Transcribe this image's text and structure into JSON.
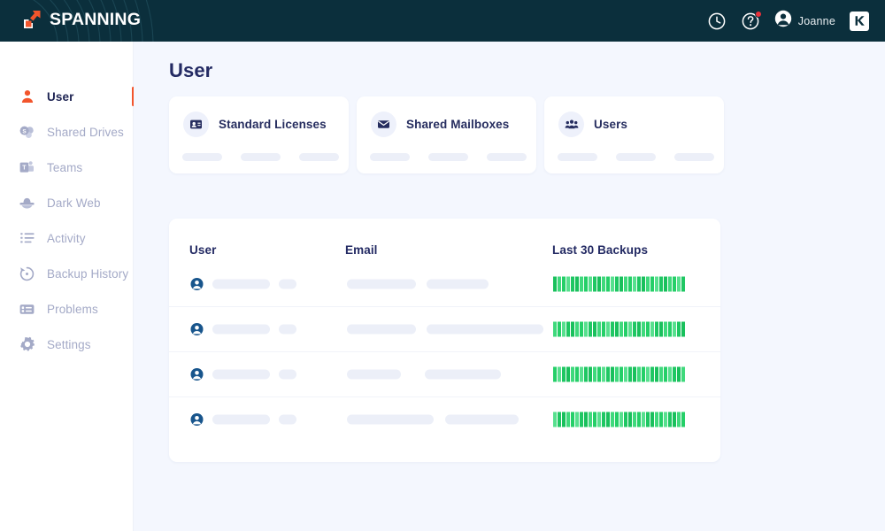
{
  "brand": {
    "name": "SPANNING",
    "logo_icon": "spanning-arrow-logo",
    "header_bg": "#0b2f3c",
    "accent": "#f2552c"
  },
  "topbar": {
    "history_icon": "clock-icon",
    "help_icon": "help-circle-icon",
    "help_has_notification": true,
    "notification_color": "#e8313a",
    "avatar_icon": "user-avatar-icon",
    "user_name": "Joanne",
    "app_switcher_icon": "kaseya-k-logo",
    "app_switcher_label": "K"
  },
  "sidebar": {
    "items": [
      {
        "label": "User",
        "icon": "user-icon",
        "active": true
      },
      {
        "label": "Shared Drives",
        "icon": "shared-drives-icon",
        "active": false
      },
      {
        "label": "Teams",
        "icon": "teams-icon",
        "active": false
      },
      {
        "label": "Dark Web",
        "icon": "dark-web-icon",
        "active": false
      },
      {
        "label": "Activity",
        "icon": "activity-list-icon",
        "active": false
      },
      {
        "label": "Backup History",
        "icon": "backup-history-icon",
        "active": false
      },
      {
        "label": "Problems",
        "icon": "problems-icon",
        "active": false
      },
      {
        "label": "Settings",
        "icon": "gear-icon",
        "active": false
      }
    ]
  },
  "main": {
    "page_title": "User",
    "background": "#f4f7fe",
    "stat_cards": [
      {
        "label": "Standard Licenses",
        "icon": "id-card-icon",
        "loading": true,
        "skeleton_widths": [
          45,
          45,
          45
        ]
      },
      {
        "label": "Shared Mailboxes",
        "icon": "envelope-icon",
        "loading": true,
        "skeleton_widths": [
          45,
          45,
          45
        ]
      },
      {
        "label": "Users",
        "icon": "group-users-icon",
        "loading": true,
        "skeleton_widths": [
          45,
          45,
          45
        ]
      }
    ],
    "table": {
      "columns": [
        {
          "key": "user",
          "label": "User"
        },
        {
          "key": "email",
          "label": "Email"
        },
        {
          "key": "backups",
          "label": "Last 30 Backups"
        }
      ],
      "loading": true,
      "rows": [
        {
          "avatar_icon": "user-avatar-icon",
          "user_skeleton_widths": [
            65,
            20
          ],
          "email_skeleton_widths": [
            78,
            70
          ],
          "email_skeleton_gap": 12,
          "backups": {
            "count": 30,
            "status": "success",
            "color": "#22c55e"
          }
        },
        {
          "avatar_icon": "user-avatar-icon",
          "user_skeleton_widths": [
            65,
            20
          ],
          "email_skeleton_widths": [
            78,
            132
          ],
          "email_skeleton_gap": 12,
          "backups": {
            "count": 30,
            "status": "success",
            "color": "#22c55e"
          }
        },
        {
          "avatar_icon": "user-avatar-icon",
          "user_skeleton_widths": [
            65,
            20
          ],
          "email_skeleton_widths": [
            61,
            86
          ],
          "email_skeleton_gap": 27,
          "backups": {
            "count": 30,
            "status": "success",
            "color": "#22c55e"
          }
        },
        {
          "avatar_icon": "user-avatar-icon",
          "user_skeleton_widths": [
            65,
            20
          ],
          "email_skeleton_widths": [
            98,
            83
          ],
          "email_skeleton_gap": 13,
          "backups": {
            "count": 30,
            "status": "success",
            "color": "#22c55e"
          }
        }
      ]
    }
  }
}
